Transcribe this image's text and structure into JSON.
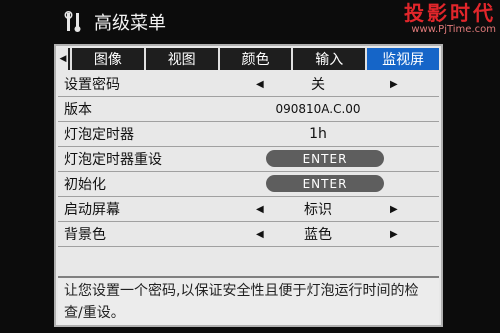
{
  "watermark": {
    "main": "投影时代",
    "url": "www.PjTime.com"
  },
  "menu": {
    "title": "高级菜单",
    "tabs": [
      {
        "label": "图像",
        "active": false
      },
      {
        "label": "视图",
        "active": false
      },
      {
        "label": "颜色",
        "active": false
      },
      {
        "label": "输入",
        "active": false
      },
      {
        "label": "监视屏",
        "active": true
      }
    ],
    "rows": [
      {
        "label": "设置密码",
        "value": "关",
        "arrows": true,
        "button": false
      },
      {
        "label": "版本",
        "value": "090810A.C.00",
        "arrows": false,
        "button": false
      },
      {
        "label": "灯泡定时器",
        "value": "1h",
        "arrows": false,
        "button": false
      },
      {
        "label": "灯泡定时器重设",
        "value": "ENTER",
        "arrows": false,
        "button": true
      },
      {
        "label": "初始化",
        "value": "ENTER",
        "arrows": false,
        "button": true
      },
      {
        "label": "启动屏幕",
        "value": "标识",
        "arrows": true,
        "button": false
      },
      {
        "label": "背景色",
        "value": "蓝色",
        "arrows": true,
        "button": false
      }
    ],
    "help_text": "让您设置一个密码,以保证安全性且便于灯泡运行时间的检查/重设。"
  },
  "colors": {
    "active_tab": "#1565c8",
    "panel": "#e8e8e8",
    "watermark": "#e1262b"
  },
  "icons": {
    "title": "wrench-icon",
    "tab_scroll": "triangle-left-icon",
    "prev": "triangle-left-icon",
    "next": "triangle-right-icon"
  }
}
